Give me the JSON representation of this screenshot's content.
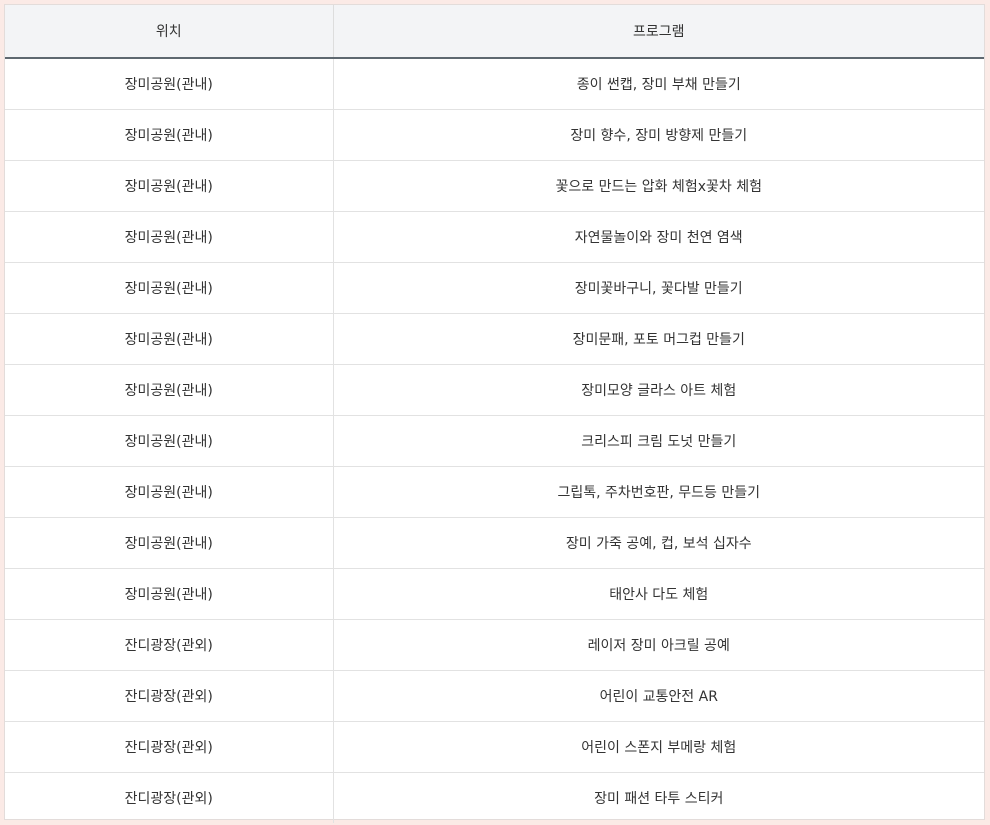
{
  "table": {
    "headers": [
      "위치",
      "프로그램"
    ],
    "rows": [
      {
        "location": "장미공원(관내)",
        "program": "종이 썬캡, 장미 부채 만들기"
      },
      {
        "location": "장미공원(관내)",
        "program": "장미 향수, 장미 방향제 만들기"
      },
      {
        "location": "장미공원(관내)",
        "program": "꽃으로 만드는 압화 체험x꽃차 체험"
      },
      {
        "location": "장미공원(관내)",
        "program": "자연물놀이와 장미 천연 염색"
      },
      {
        "location": "장미공원(관내)",
        "program": "장미꽃바구니, 꽃다발 만들기"
      },
      {
        "location": "장미공원(관내)",
        "program": "장미문패, 포토 머그컵 만들기"
      },
      {
        "location": "장미공원(관내)",
        "program": "장미모양 글라스 아트 체험"
      },
      {
        "location": "장미공원(관내)",
        "program": "크리스피 크림 도넛 만들기"
      },
      {
        "location": "장미공원(관내)",
        "program": "그립톡, 주차번호판, 무드등 만들기"
      },
      {
        "location": "장미공원(관내)",
        "program": "장미 가죽 공예, 컵, 보석 십자수"
      },
      {
        "location": "장미공원(관내)",
        "program": "태안사 다도 체험"
      },
      {
        "location": "잔디광장(관외)",
        "program": "레이저 장미 아크릴 공예"
      },
      {
        "location": "잔디광장(관외)",
        "program": "어린이 교통안전 AR"
      },
      {
        "location": "잔디광장(관외)",
        "program": "어린이 스폰지 부메랑 체험"
      },
      {
        "location": "잔디광장(관외)",
        "program": "장미 패션 타투 스티커"
      }
    ]
  },
  "colors": {
    "page_background": "#fbeae6",
    "header_background": "#f3f4f6",
    "header_rule": "#5e6870",
    "row_divider": "#e2e2e2",
    "text": "#333333"
  }
}
